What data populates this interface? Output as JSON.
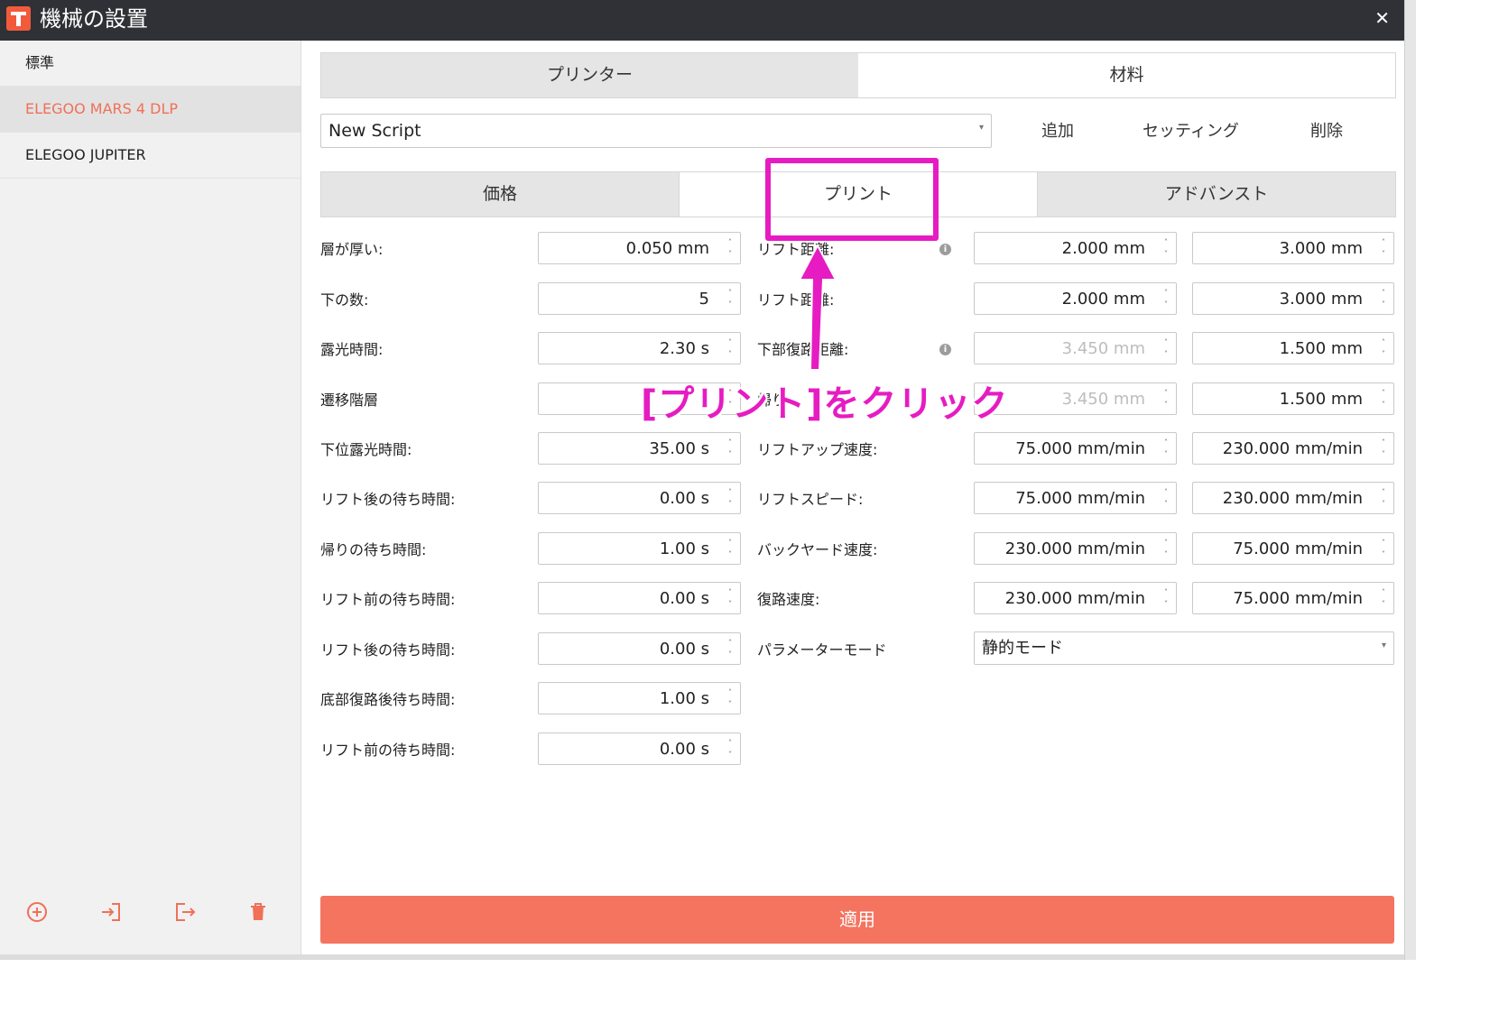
{
  "window": {
    "title": "機械の設置",
    "close_glyph": "✕"
  },
  "sidebar": {
    "items": [
      {
        "label": "標準",
        "active": false
      },
      {
        "label": "ELEGOO MARS 4 DLP",
        "active": true
      },
      {
        "label": "ELEGOO JUPITER",
        "active": false
      }
    ],
    "tools": [
      "add-circle-icon",
      "import-icon",
      "export-icon",
      "trash-icon"
    ]
  },
  "main": {
    "tabs": [
      "プリンター",
      "材料"
    ],
    "selected_tab": "プリンター",
    "script_value": "New Script",
    "actions": {
      "add": "追加",
      "settings": "セッティング",
      "delete": "削除"
    },
    "subtabs": [
      "価格",
      "プリント",
      "アドバンスト"
    ],
    "selected_subtab": "価格"
  },
  "left_fields": [
    {
      "label": "層が厚い:",
      "value": "0.050 mm"
    },
    {
      "label": "下の数:",
      "value": "5"
    },
    {
      "label": "露光時間:",
      "value": "2.30 s"
    },
    {
      "label": "遷移階層",
      "value": ""
    },
    {
      "label": "下位露光時間:",
      "value": "35.00 s"
    },
    {
      "label": "リフト後の待ち時間:",
      "value": "0.00 s"
    },
    {
      "label": "帰りの待ち時間:",
      "value": "1.00 s"
    },
    {
      "label": "リフト前の待ち時間:",
      "value": "0.00 s"
    },
    {
      "label": "リフト後の待ち時間:",
      "value": "0.00 s"
    },
    {
      "label": "底部復路後待ち時間:",
      "value": "1.00 s"
    },
    {
      "label": "リフト前の待ち時間:",
      "value": "0.00 s"
    }
  ],
  "right_fields": [
    {
      "label": "リフト距離:",
      "v1": "2.000 mm",
      "v2": "3.000 mm",
      "info": true,
      "v1_disabled": false
    },
    {
      "label": "リフト距離:",
      "v1": "2.000 mm",
      "v2": "3.000 mm",
      "info": false,
      "v1_disabled": false
    },
    {
      "label": "下部復路距離:",
      "v1": "3.450 mm",
      "v2": "1.500 mm",
      "info": true,
      "v1_disabled": true
    },
    {
      "label": "帰り:",
      "v1": "3.450 mm",
      "v2": "1.500 mm",
      "info": false,
      "v1_disabled": true
    },
    {
      "label": "リフトアップ速度:",
      "v1": "75.000 mm/min",
      "v2": "230.000 mm/min",
      "info": false,
      "v1_disabled": false
    },
    {
      "label": "リフトスピード:",
      "v1": "75.000 mm/min",
      "v2": "230.000 mm/min",
      "info": false,
      "v1_disabled": false
    },
    {
      "label": "バックヤード速度:",
      "v1": "230.000 mm/min",
      "v2": "75.000 mm/min",
      "info": false,
      "v1_disabled": false
    },
    {
      "label": "復路速度:",
      "v1": "230.000 mm/min",
      "v2": "75.000 mm/min",
      "info": false,
      "v1_disabled": false
    }
  ],
  "parameter_mode": {
    "label": "パラメーターモード",
    "value": "静的モード"
  },
  "apply_label": "適用",
  "annotation": {
    "text": "[プリント]をクリック",
    "color": "#e61cc2"
  },
  "colors": {
    "accent": "#f47460",
    "titlebar": "#2f3136",
    "annotation": "#e61cc2"
  }
}
